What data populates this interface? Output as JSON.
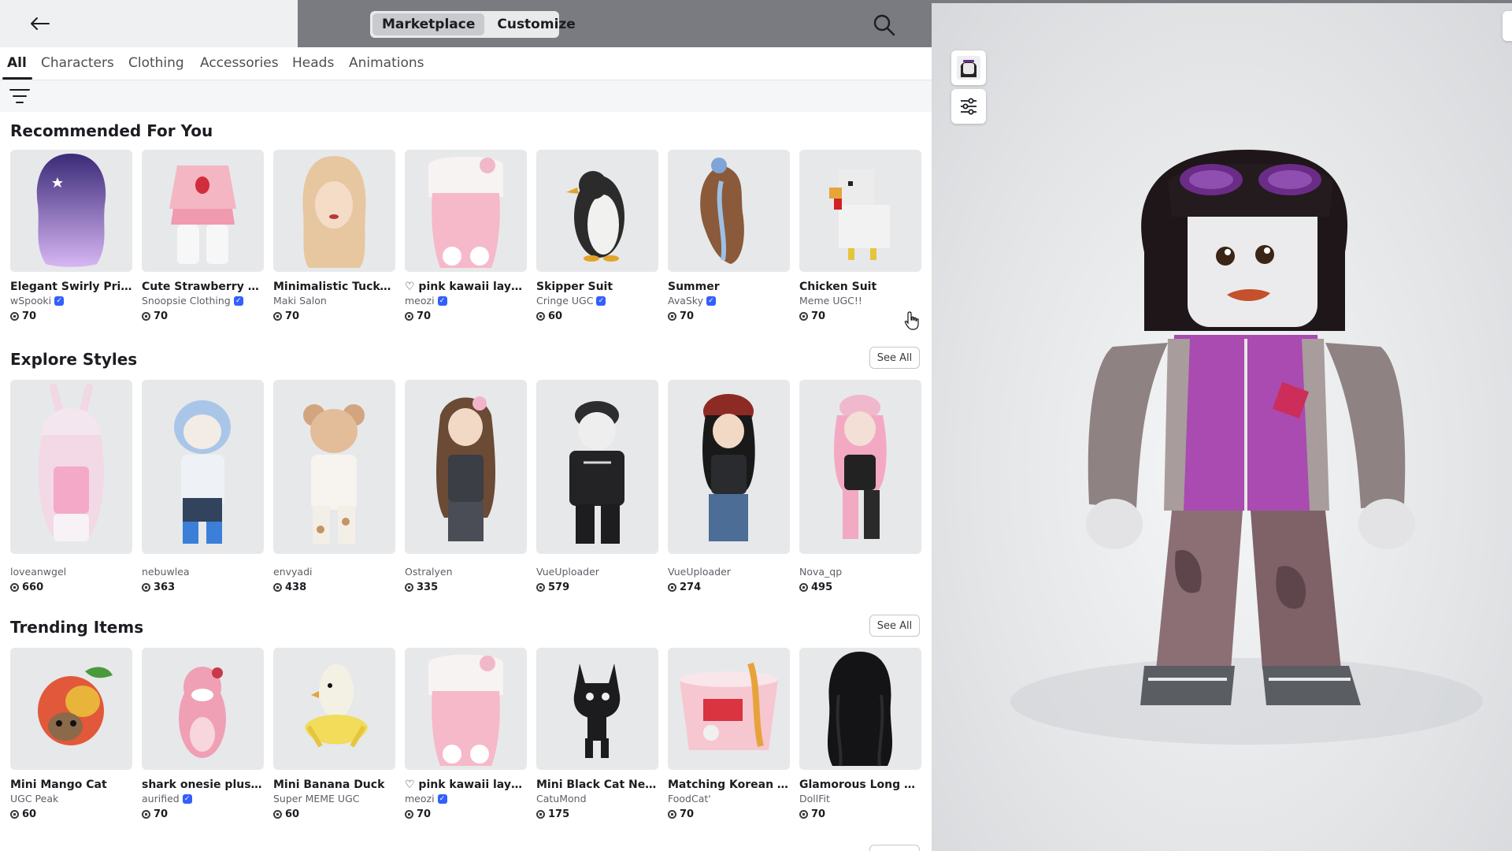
{
  "topbar": {
    "modes": [
      {
        "label": "Marketplace",
        "active": true
      },
      {
        "label": "Customize",
        "active": false
      }
    ]
  },
  "tabs": [
    "All",
    "Characters",
    "Clothing",
    "Accessories",
    "Heads",
    "Animations"
  ],
  "sections": {
    "recommended": {
      "title": "Recommended For You",
      "items": [
        {
          "name": "Elegant Swirly Princ...",
          "creator": "wSpooki",
          "verified": true,
          "price": "70"
        },
        {
          "name": "Cute Strawberry Out...",
          "creator": "Snoopsie Clothing",
          "verified": true,
          "price": "70"
        },
        {
          "name": "Minimalistic Tucked ...",
          "creator": "Maki Salon",
          "verified": false,
          "price": "70"
        },
        {
          "name": "♡ pink kawaii layere...",
          "creator": "meozi",
          "verified": true,
          "price": "70"
        },
        {
          "name": "Skipper Suit",
          "creator": "Cringe UGC",
          "verified": true,
          "price": "60"
        },
        {
          "name": "Summer",
          "creator": "AvaSky",
          "verified": true,
          "price": "70"
        },
        {
          "name": "Chicken Suit",
          "creator": "Meme UGC!!",
          "verified": false,
          "price": "70"
        }
      ]
    },
    "explore": {
      "title": "Explore Styles",
      "see_all": "See All",
      "items": [
        {
          "creator": "loveanwgel",
          "price": "660"
        },
        {
          "creator": "nebuwlea",
          "price": "363"
        },
        {
          "creator": "envyadi",
          "price": "438"
        },
        {
          "creator": "Ostralyen",
          "price": "335"
        },
        {
          "creator": "VueUploader",
          "price": "579"
        },
        {
          "creator": "VueUploader",
          "price": "274"
        },
        {
          "creator": "Nova_qp",
          "price": "495"
        }
      ]
    },
    "trending": {
      "title": "Trending Items",
      "see_all": "See All",
      "items": [
        {
          "name": "Mini Mango Cat",
          "creator": "UGC Peak",
          "verified": false,
          "price": "60"
        },
        {
          "name": "shark onesie plushie",
          "creator": "aurified",
          "verified": true,
          "price": "70"
        },
        {
          "name": "Mini Banana Duck",
          "creator": "Super MEME UGC",
          "verified": false,
          "price": "60"
        },
        {
          "name": "♡ pink kawaii layere...",
          "creator": "meozi",
          "verified": true,
          "price": "70"
        },
        {
          "name": "Mini Black Cat Neon",
          "creator": "CatuMond",
          "verified": false,
          "price": "175"
        },
        {
          "name": "Matching Korean Bu...",
          "creator": "FoodCat'",
          "verified": false,
          "price": "70"
        },
        {
          "name": "Glamorous Long Bla...",
          "creator": "DollFit",
          "verified": false,
          "price": "70"
        }
      ]
    }
  },
  "icons": {
    "back": "arrow-left-icon",
    "search": "search-icon",
    "filter": "filter-icon",
    "avatar": "avatar-headshot-icon",
    "settings": "sliders-icon",
    "currency": "robux-icon",
    "verified": "verified-badge-icon"
  }
}
